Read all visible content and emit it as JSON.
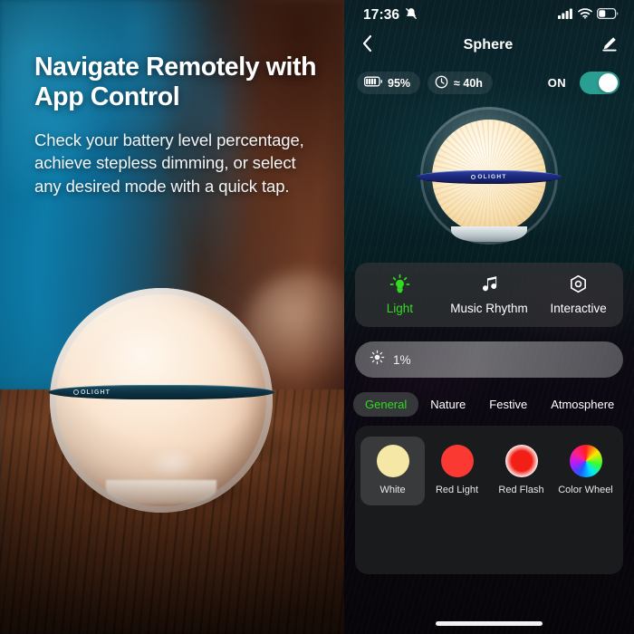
{
  "marketing": {
    "headline": "Navigate Remotely with App Control",
    "body": "Check your battery level percentage, achieve stepless dimming, or select any desired mode with a quick tap.",
    "product_logo": "OLIGHT"
  },
  "phone": {
    "status_bar": {
      "time": "17:36",
      "mute_icon": "bell-slash-icon",
      "signal_icon": "cellular-signal-icon",
      "wifi_icon": "wifi-icon",
      "battery_icon": "battery-icon"
    },
    "nav": {
      "back_icon": "chevron-left-icon",
      "title": "Sphere",
      "edit_icon": "pencil-edit-icon"
    },
    "status_pills": {
      "battery_icon": "battery-full-icon",
      "battery_value": "95%",
      "runtime_icon": "clock-icon",
      "runtime_value": "≈ 40h",
      "power_label": "ON",
      "power_on": true
    },
    "device": {
      "name": "Sphere",
      "brand": "OLIGHT"
    },
    "modes": [
      {
        "label": "Light",
        "icon": "light-bulb-icon",
        "active": true
      },
      {
        "label": "Music Rhythm",
        "icon": "music-note-icon",
        "active": false
      },
      {
        "label": "Interactive",
        "icon": "hexagon-gear-icon",
        "active": false
      }
    ],
    "brightness": {
      "icon": "brightness-sun-icon",
      "value": "1%",
      "percent": 1
    },
    "tabs": [
      {
        "label": "General",
        "active": true
      },
      {
        "label": "Nature",
        "active": false
      },
      {
        "label": "Festive",
        "active": false
      },
      {
        "label": "Atmosphere",
        "active": false
      }
    ],
    "presets": [
      {
        "label": "White",
        "color": "#F5E8A6",
        "style": "solid",
        "selected": true
      },
      {
        "label": "Red Light",
        "color": "#FA3A32",
        "style": "solid",
        "selected": false
      },
      {
        "label": "Red Flash",
        "color": "#F11F16",
        "style": "glow",
        "selected": false
      },
      {
        "label": "Color Wheel",
        "color": "rainbow",
        "style": "wheel",
        "selected": false
      }
    ]
  },
  "colors": {
    "accent_green": "#2fdc1e",
    "toggle_teal": "#2b9e92",
    "phone_top_bg": "#0b2930",
    "phone_bottom_bg": "#0a0710"
  }
}
